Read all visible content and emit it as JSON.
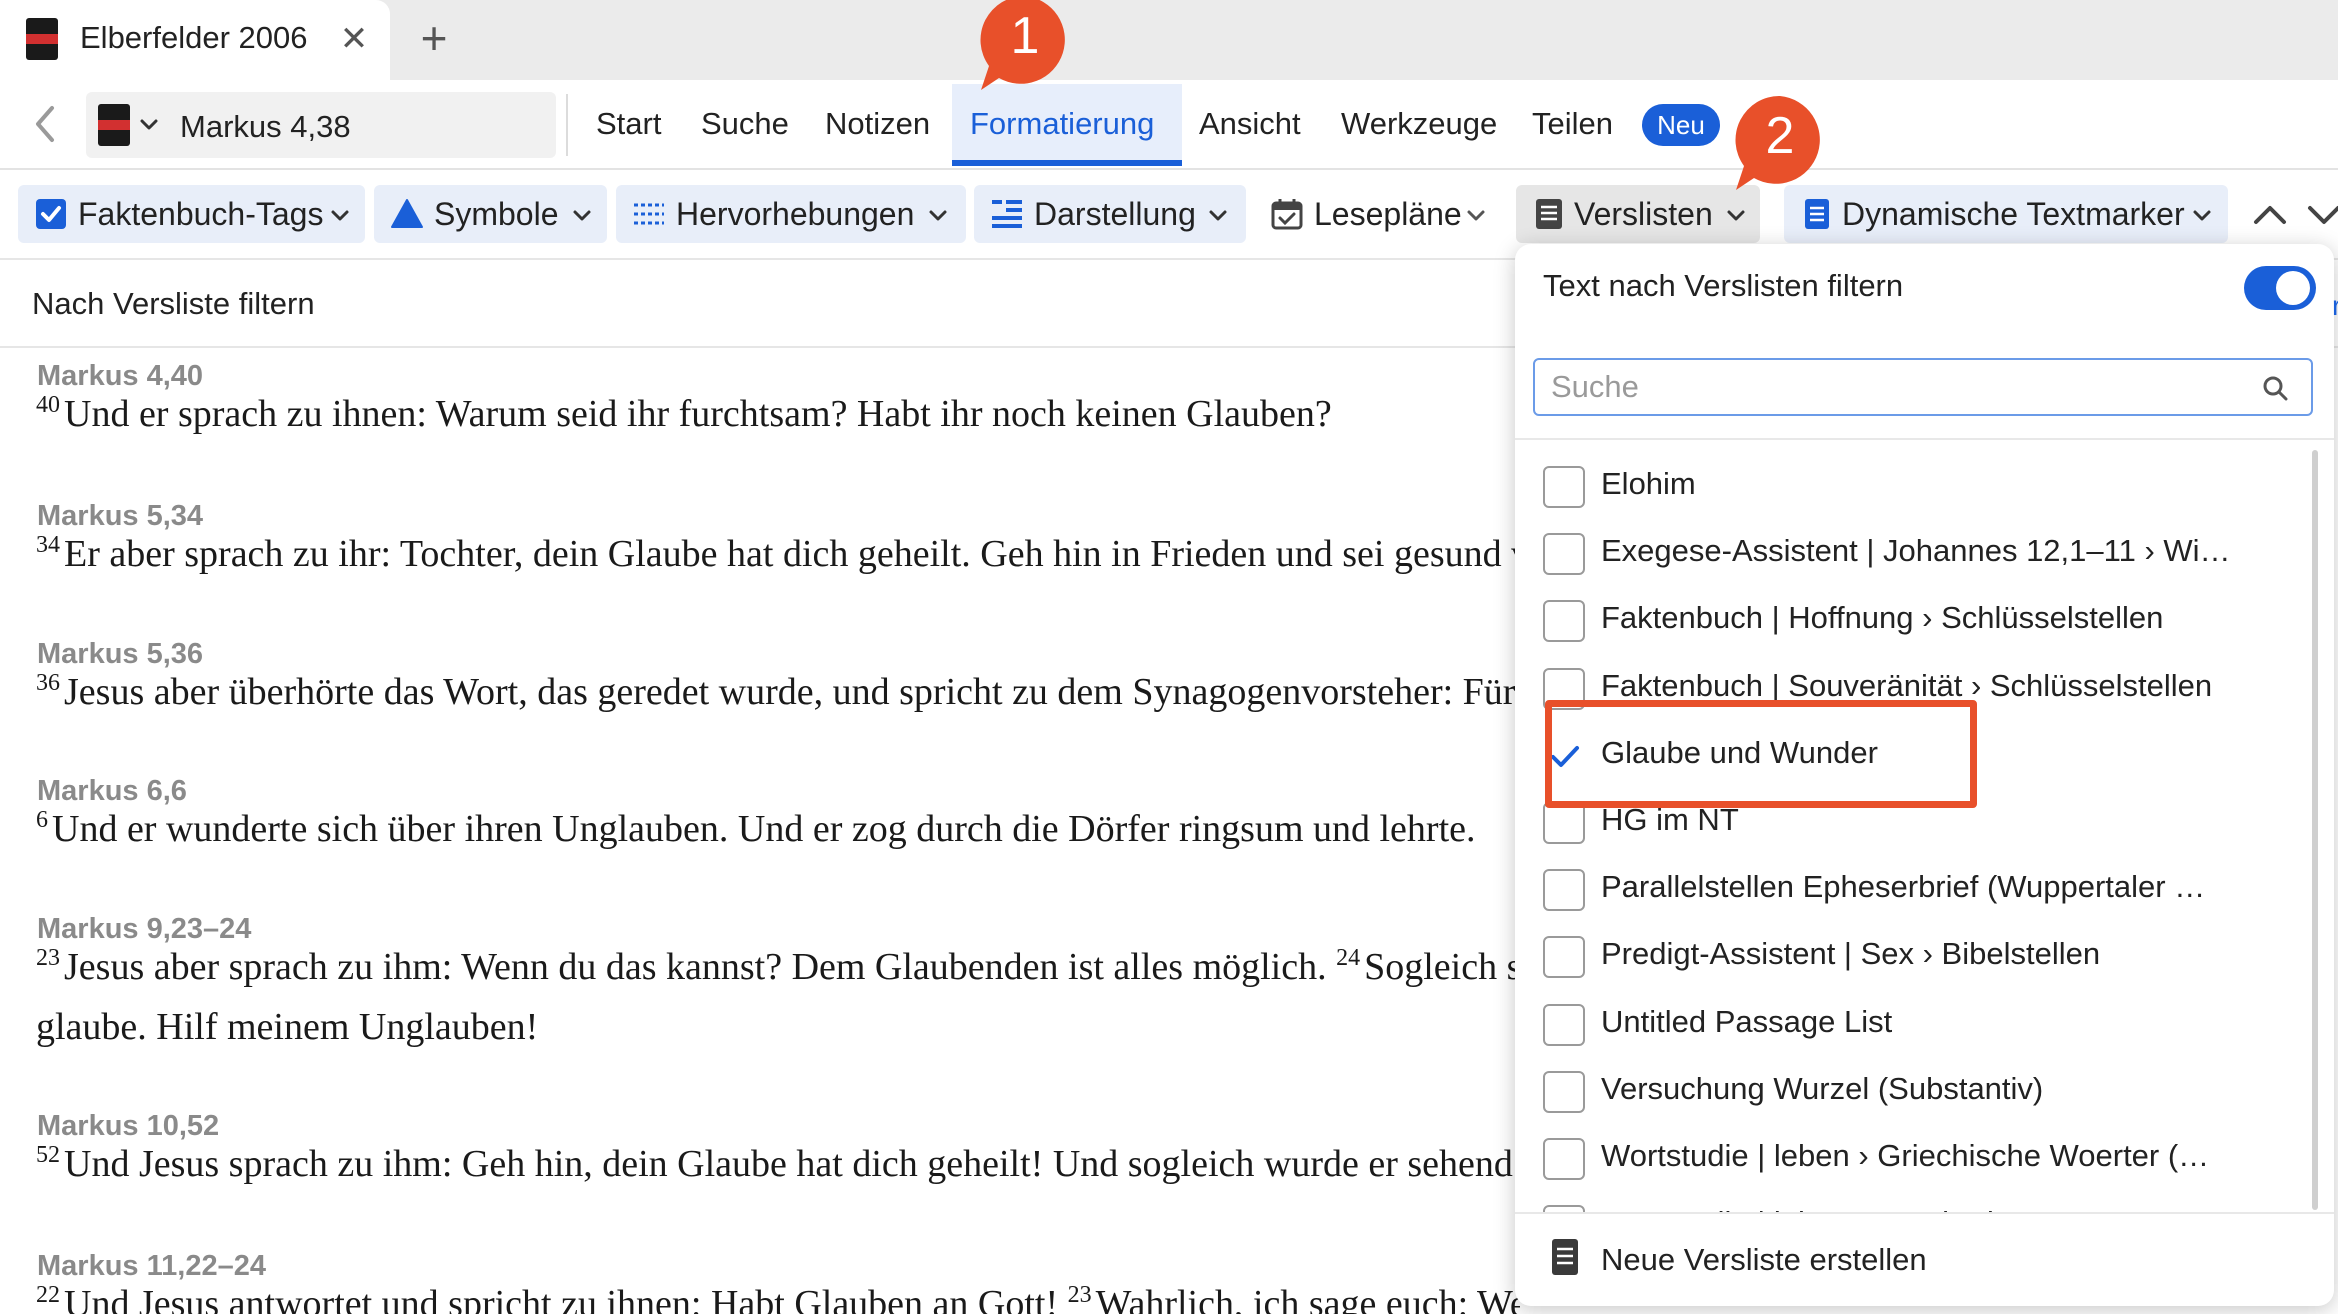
{
  "tabs": {
    "doc_title": "Elberfelder 2006",
    "close": "✕",
    "add": "+"
  },
  "menu": {
    "reference": "Markus 4,38",
    "items": [
      "Start",
      "Suche",
      "Notizen",
      "Formatierung",
      "Ansicht",
      "Werkzeuge",
      "Teilen"
    ],
    "active": "Formatierung",
    "badge": "Neu"
  },
  "ribbon": {
    "buttons": [
      "Faktenbuch-Tags",
      "Symbole",
      "Hervorhebungen",
      "Darstellung",
      "Lesepläne",
      "Verslisten",
      "Dynamische Textmarker"
    ],
    "active": "Verslisten"
  },
  "filter_header": "Nach Versliste filtern",
  "verses": [
    {
      "ref": "Markus 4,40",
      "lines": [
        [
          {
            "n": "40",
            "t": "Und er sprach zu ihnen: Warum seid ihr furchtsam? Habt ihr noch keinen Glauben?"
          }
        ]
      ]
    },
    {
      "ref": "Markus 5,34",
      "lines": [
        [
          {
            "n": "34",
            "t": "Er aber sprach zu ihr: Tochter, dein Glaube hat dich geheilt. Geh hin in Frieden und sei gesund von deiner Plage!"
          }
        ]
      ]
    },
    {
      "ref": "Markus 5,36",
      "lines": [
        [
          {
            "n": "36",
            "t": "Jesus aber überhörte das Wort, das geredet wurde, und spricht zu dem Synagogenvorsteher: Fürchte dich nicht; glaube nur!"
          }
        ]
      ]
    },
    {
      "ref": "Markus 6,6",
      "lines": [
        [
          {
            "n": "6",
            "t": "Und er wunderte sich über ihren Unglauben. Und er zog durch die Dörfer ringsum und lehrte."
          }
        ]
      ]
    },
    {
      "ref": "Markus 9,23–24",
      "lines": [
        [
          {
            "n": "23",
            "t": "Jesus aber sprach zu ihm: Wenn du das kannst? Dem Glaubenden ist alles möglich. "
          },
          {
            "n": "24",
            "t": "Sogleich schrie der Vater des Kindes und sagte: Ich"
          }
        ],
        [
          {
            "n": "",
            "t": "glaube. Hilf meinem Unglauben!"
          }
        ]
      ]
    },
    {
      "ref": "Markus 10,52",
      "lines": [
        [
          {
            "n": "52",
            "t": "Und Jesus sprach zu ihm: Geh hin, dein Glaube hat dich geheilt! Und sogleich wurde er sehend und folgte ihm nach auf dem Weg."
          }
        ]
      ]
    },
    {
      "ref": "Markus 11,22–24",
      "lines": [
        [
          {
            "n": "22",
            "t": "Und Jesus antwortet und spricht zu ihnen: Habt Glauben an Gott! "
          },
          {
            "n": "23",
            "t": "Wahrlich, ich sage euch: Wer zu diesem Berg sagen wird: Hebe dich"
          }
        ]
      ]
    }
  ],
  "panel": {
    "title": "Text nach Verslisten filtern",
    "toggle_on": true,
    "search_placeholder": "Suche",
    "items": [
      {
        "label": "Elohim",
        "checked": false
      },
      {
        "label": "Exegese-Assistent | Johannes 12,1–11 › Wi…",
        "checked": false
      },
      {
        "label": "Faktenbuch | Hoffnung › Schlüsselstellen",
        "checked": false
      },
      {
        "label": "Faktenbuch | Souveränität › Schlüsselstellen",
        "checked": false
      },
      {
        "label": "Glaube und Wunder",
        "checked": true
      },
      {
        "label": "HG im NT",
        "checked": false
      },
      {
        "label": "Parallelstellen Epheserbrief (Wuppertaler …",
        "checked": false
      },
      {
        "label": "Predigt-Assistent | Sex › Bibelstellen",
        "checked": false
      },
      {
        "label": "Untitled Passage List",
        "checked": false
      },
      {
        "label": "Versuchung Wurzel (Substantiv)",
        "checked": false
      },
      {
        "label": "Wortstudie | leben › Griechische Woerter (…",
        "checked": false
      },
      {
        "label": "Wortstudie | leben › Wortbedeutung",
        "checked": false
      }
    ],
    "new_list": "Neue Versliste erstellen"
  },
  "annotations": {
    "callout1": "1",
    "callout2": "2",
    "color": "#e8502a"
  },
  "colors": {
    "accent": "#1a5fd8",
    "annotation": "#e8502a",
    "ref_gray": "#8a8a8a"
  }
}
